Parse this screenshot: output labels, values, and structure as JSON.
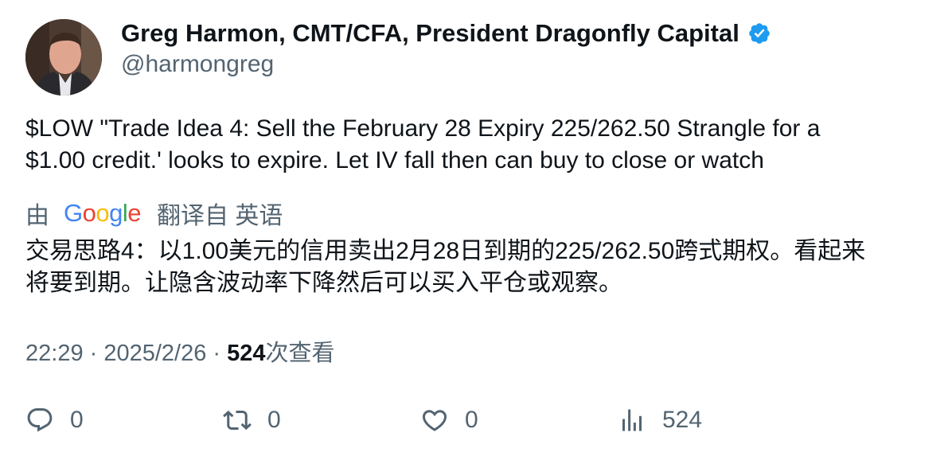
{
  "author": {
    "display_name": "Greg Harmon, CMT/CFA, President Dragonfly Capital",
    "handle": "@harmongreg",
    "verified_color": "#1d9bf0"
  },
  "tweet": {
    "text_line1": "$LOW \"Trade Idea 4: Sell the February 28 Expiry 225/262.50 Strangle for a",
    "text_line2": "$1.00 credit.' looks to expire.  Let IV fall then can buy to close or watch"
  },
  "translation": {
    "by_label": "由",
    "provider_letters": [
      "G",
      "o",
      "o",
      "g",
      "l",
      "e"
    ],
    "provider_colors": [
      "#4285F4",
      "#EA4335",
      "#FBBC05",
      "#4285F4",
      "#34A853",
      "#EA4335"
    ],
    "from_label": "翻译自 英语",
    "text_line1": "交易思路4：以1.00美元的信用卖出2月28日到期的225/262.50跨式期权。看起来",
    "text_line2": "将要到期。让隐含波动率下降然后可以买入平仓或观察。"
  },
  "meta": {
    "time": "22:29",
    "separator": " · ",
    "date": "2025/2/26",
    "views_count": "524",
    "views_label": "次查看"
  },
  "actions": {
    "reply_count": "0",
    "retweet_count": "0",
    "like_count": "0",
    "views_count": "524"
  },
  "icons": {
    "reply": "reply-icon",
    "retweet": "retweet-icon",
    "like": "heart-icon",
    "views": "analytics-icon",
    "verified": "verified-badge-icon"
  }
}
